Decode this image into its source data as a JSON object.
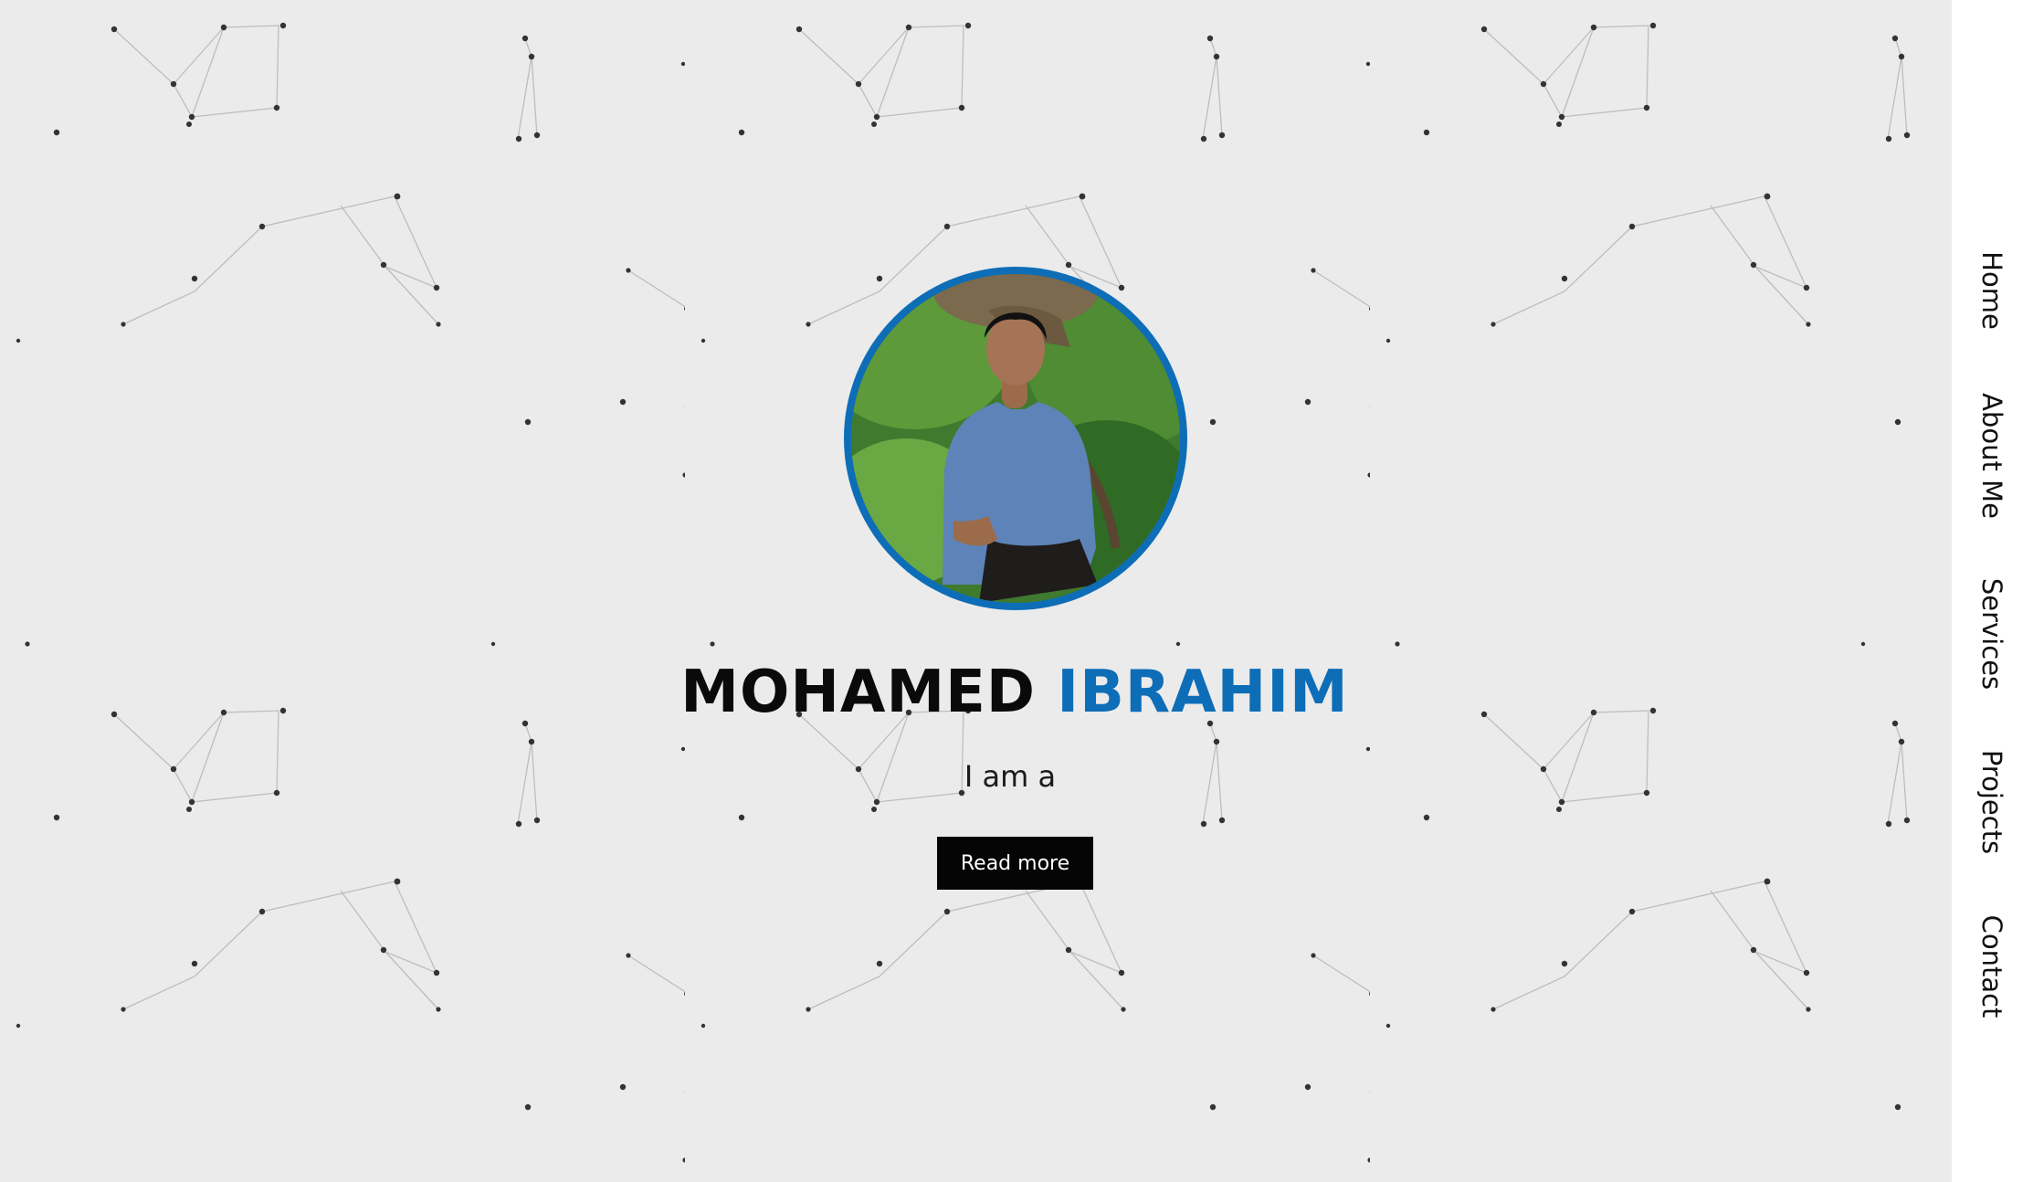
{
  "hero": {
    "first_name": "MOHAMED",
    "last_name": "IBRAHIM",
    "tagline": "I am a",
    "cta_label": "Read more",
    "avatar_icon": "profile-photo",
    "background_pattern": "constellation-network"
  },
  "nav": {
    "items": [
      {
        "label": "Home"
      },
      {
        "label": "About Me"
      },
      {
        "label": "Services"
      },
      {
        "label": "Projects"
      },
      {
        "label": "Contact"
      }
    ]
  },
  "colors": {
    "accent": "#0e6db7",
    "background": "#ebebeb",
    "button": "#050505",
    "nav_background": "#ffffff"
  }
}
